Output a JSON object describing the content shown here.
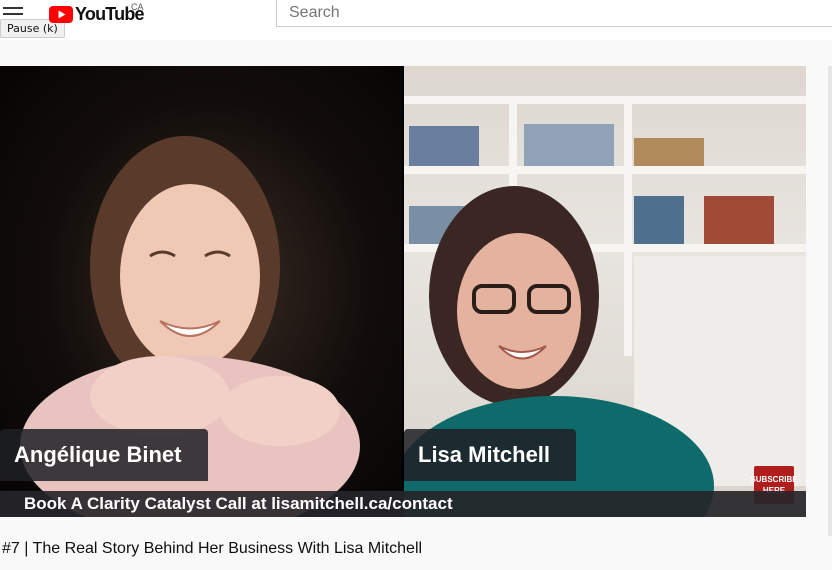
{
  "header": {
    "logo_text": "YouTube",
    "country_code": "CA",
    "menu_icon": "hamburger-menu-icon",
    "tooltip": "Pause (k)",
    "search_placeholder": "Search"
  },
  "video": {
    "lower_third_left": "Angélique Binet",
    "lower_third_right": "Lisa Mitchell",
    "banner": "Book A Clarity Catalyst Call at lisamitchell.ca/contact",
    "subscribe_badge": "SUBSCRIBE HERE",
    "title": "#7 | The Real Story Behind Her Business With Lisa Mitchell"
  },
  "colors": {
    "youtube_red": "#ff0000",
    "subscribe_red": "#b01d1d"
  }
}
